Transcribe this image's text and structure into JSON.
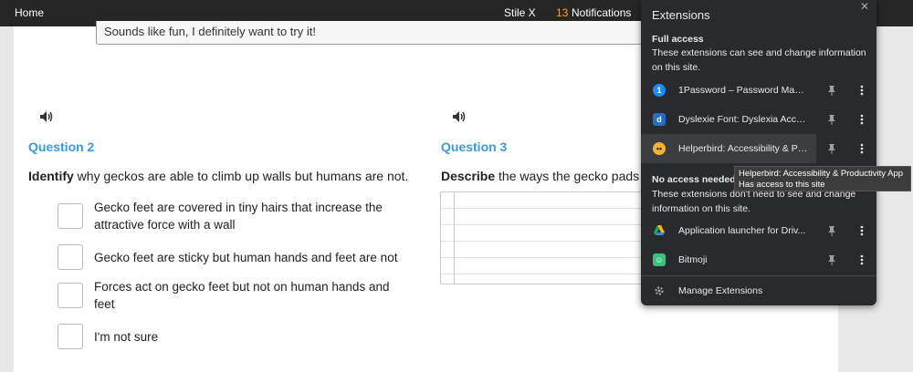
{
  "topbar": {
    "home": "Home",
    "stile": "Stile X",
    "notifications_count": "13",
    "notifications_label": "Notifications"
  },
  "lesson": {
    "previous_answer": "Sounds like fun, I definitely want to try it!",
    "question2": {
      "title": "Question 2",
      "prompt_verb": "Identify",
      "prompt_rest": " why geckos are able to climb up walls but humans are not.",
      "options": [
        "Gecko feet are covered in tiny hairs that increase the attractive force with a wall",
        "Gecko feet are sticky but human hands and feet are not",
        "Forces act on gecko feet but not on human hands and feet",
        "I'm not sure"
      ]
    },
    "question3": {
      "title": "Question 3",
      "prompt_verb": "Describe",
      "prompt_rest": " the ways the gecko pads co"
    }
  },
  "extensions": {
    "title": "Extensions",
    "full_access_title": "Full access",
    "full_access_desc": "These extensions can see and change information on this site.",
    "full_access_items": [
      {
        "name": "1Password – Password Mana...",
        "icon": "1password-icon",
        "color": "#1a8cff",
        "glyph": "1"
      },
      {
        "name": "Dyslexie Font: Dyslexia Acce...",
        "icon": "dyslexie-icon",
        "color": "#2a6dbf",
        "glyph": "d"
      },
      {
        "name": "Helperbird: Accessibility & Pr...",
        "icon": "helperbird-icon",
        "color": "#f2b233",
        "glyph": "•"
      }
    ],
    "no_access_title": "No access needed",
    "no_access_desc": "These extensions don't need to see and change information on this site.",
    "no_access_items": [
      {
        "name": "Application launcher for Driv...",
        "icon": "drive-icon",
        "color": "#1fa463",
        "glyph": "▲"
      },
      {
        "name": "Bitmoji",
        "icon": "bitmoji-icon",
        "color": "#3dc07f",
        "glyph": "☺"
      }
    ],
    "manage": "Manage Extensions",
    "tooltip_line1": "Helperbird: Accessibility & Productivity App",
    "tooltip_line2": "Has access to this site"
  }
}
